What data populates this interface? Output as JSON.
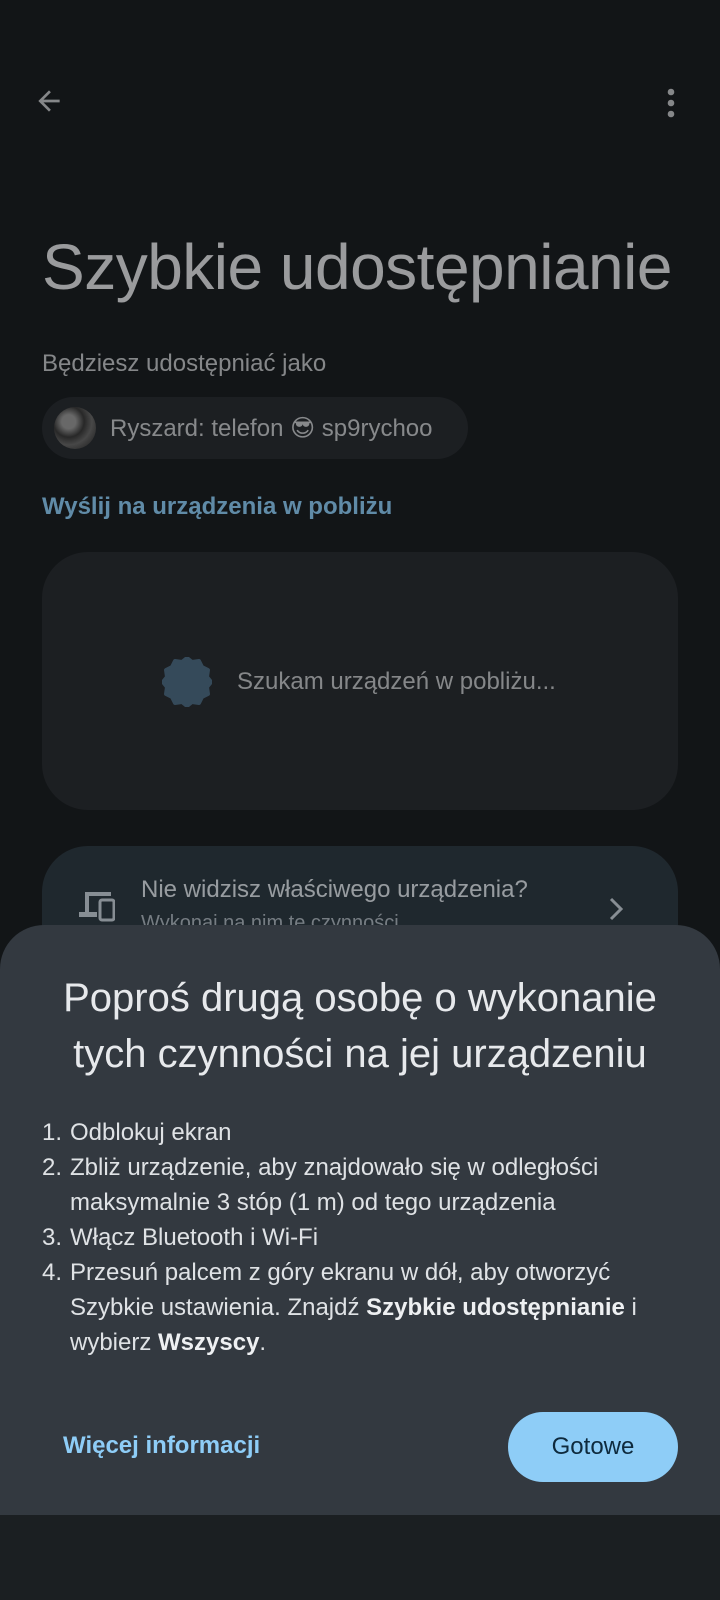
{
  "header": {
    "back_icon": "arrow-left-icon",
    "menu_icon": "more-vert-icon"
  },
  "page": {
    "title": "Szybkie udostępnianie",
    "share_as_label": "Będziesz udostępniać jako",
    "device_name": "Ryszard: telefon 😎 sp9rychoo",
    "nearby_section": "Wyślij na urządzenia w pobliżu",
    "searching_text": "Szukam urządzeń w pobliżu...",
    "hint_title": "Nie widzisz właściwego urządzenia?",
    "hint_subtitle": "Wykonaj na nim te czynności"
  },
  "sheet": {
    "title_line1": "Poproś drugą osobę o wykonanie",
    "title_line2": "tych czynności na jej urządzeniu",
    "steps": [
      {
        "num": "1.",
        "text": "Odblokuj ekran"
      },
      {
        "num": "2.",
        "text": "Zbliż urządzenie, aby znajdowało się w odległości maksymalnie 3 stóp (1 m) od tego urządzenia"
      },
      {
        "num": "3.",
        "text": "Włącz Bluetooth i Wi-Fi"
      },
      {
        "num": "4.",
        "text_before": "Przesuń palcem z góry ekranu w dół, aby otworzyć Szybkie ustawienia. Znajdź ",
        "bold1": "Szybkie udostępnianie",
        "text_mid": " i wybierz ",
        "bold2": "Wszyscy",
        "text_after": "."
      }
    ],
    "more_info": "Więcej informacji",
    "done": "Gotowe"
  },
  "colors": {
    "accent": "#8ecdf7",
    "background": "#1b1f22",
    "sheet": "#333940"
  }
}
